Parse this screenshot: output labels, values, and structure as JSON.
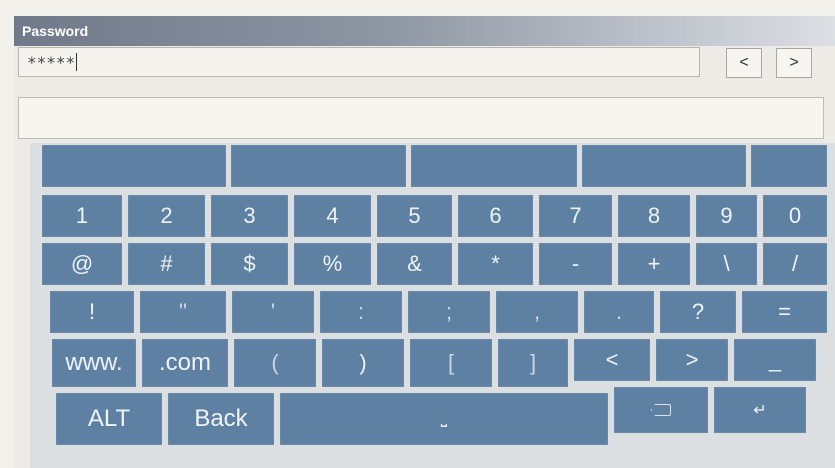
{
  "window": {
    "title": "Password"
  },
  "password_field": {
    "value": "*****"
  },
  "nav": {
    "prev": "<",
    "next": ">"
  },
  "keyboard": {
    "top_row": [
      "",
      "",
      "",
      "",
      ""
    ],
    "row1": [
      "1",
      "2",
      "3",
      "4",
      "5",
      "6",
      "7",
      "8",
      "9",
      "0"
    ],
    "row2": [
      "@",
      "#",
      "$",
      "%",
      "&",
      "*",
      "-",
      "+",
      "\\",
      "/"
    ],
    "row3": [
      "!",
      "\"",
      "'",
      ":",
      ";",
      ",",
      ".",
      "?",
      "="
    ],
    "row4": [
      "www.",
      ".com",
      "(",
      ")",
      "[",
      "]",
      "<",
      ">",
      "_"
    ],
    "row5": {
      "alt": "ALT",
      "back": "Back",
      "space": "⎵",
      "backspace_icon": "backspace-icon",
      "enter": "↵"
    }
  }
}
